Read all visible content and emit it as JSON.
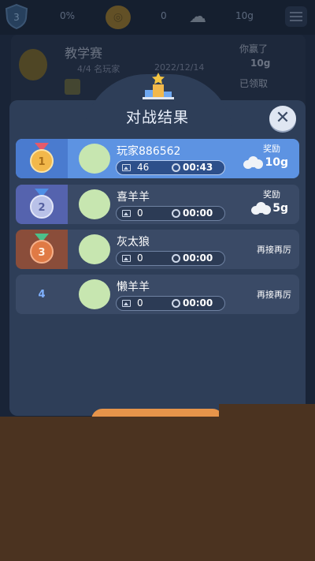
{
  "background": {
    "level": "3",
    "progress_pct": "0%",
    "zero_count": "0",
    "coins": "10g",
    "match_title": "教学赛",
    "players_text": "4/4 名玩家",
    "date": "2022/12/14",
    "won_text": "你赢了",
    "won_prize": "10g",
    "claimed_text": "已领取"
  },
  "modal": {
    "title": "对战结果",
    "close_icon": "close-icon",
    "rows": [
      {
        "rank": "1",
        "name": "玩家886562",
        "count": "46",
        "time": "00:43",
        "reward_label": "奖励",
        "reward_amount": "10g",
        "retry_text": ""
      },
      {
        "rank": "2",
        "name": "喜羊羊",
        "count": "0",
        "time": "00:00",
        "reward_label": "奖励",
        "reward_amount": "5g",
        "retry_text": ""
      },
      {
        "rank": "3",
        "name": "灰太狼",
        "count": "0",
        "time": "00:00",
        "reward_label": "",
        "reward_amount": "",
        "retry_text": "再接再厉"
      },
      {
        "rank": "4",
        "name": "懒羊羊",
        "count": "0",
        "time": "00:00",
        "reward_label": "",
        "reward_amount": "",
        "retry_text": "再接再厉"
      }
    ]
  },
  "colors": {
    "accent": "#5d93e2",
    "gold": "#f2b84b",
    "silver": "#b9c1e8",
    "bronze": "#e07a45",
    "avatar": "#c7e6b0"
  }
}
